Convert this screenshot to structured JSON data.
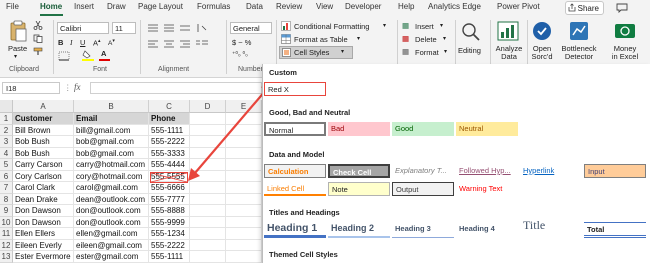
{
  "tabs": [
    "File",
    "Home",
    "Insert",
    "Draw",
    "Page Layout",
    "Formulas",
    "Data",
    "Review",
    "View",
    "Developer",
    "Help",
    "Analytics Edge",
    "Power Pivot"
  ],
  "share_label": "Share",
  "ribbon": {
    "paste": "Paste",
    "clipboard": "Clipboard",
    "font_name": "Calibri",
    "font_size": "11",
    "font_group": "Font",
    "alignment": "Alignment",
    "number_format": "General",
    "currency": "$ ~ %",
    "number_group": "Number",
    "conditional_formatting": "Conditional Formatting",
    "format_as_table": "Format as Table",
    "cell_styles": "Cell Styles",
    "insert": "Insert",
    "delete": "Delete",
    "format": "Format",
    "editing": "Editing",
    "analyze_data": "Analyze Data",
    "open_sorcd": "Open Sorc'd",
    "bottleneck_detector": "Bottleneck Detector",
    "money_in_excel": "Money in Excel"
  },
  "name_box": "I18",
  "fx_label": "fx",
  "grid": {
    "columns": [
      "A",
      "B",
      "C",
      "D",
      "E"
    ],
    "rows": [
      [
        "Customer",
        "Email",
        "Phone"
      ],
      [
        "Bill Brown",
        "bill@gmail.com",
        "555-1111"
      ],
      [
        "Bob Bush",
        "bob@gmail.com",
        "555-2222"
      ],
      [
        "Bob Bush",
        "bob@gmail.com",
        "555-3333"
      ],
      [
        "Carry Carson",
        "carry@hotmail.com",
        "555-4444"
      ],
      [
        "Cory Carlson",
        "cory@hotmail.com",
        "555-5555"
      ],
      [
        "Carol Clark",
        "carol@gmail.com",
        "555-6666"
      ],
      [
        "Dean Drake",
        "dean@outlook.com",
        "555-7777"
      ],
      [
        "Don Dawson",
        "don@outlook.com",
        "555-8888"
      ],
      [
        "Don Dawson",
        "don@outlook.com",
        "555-9999"
      ],
      [
        "Ellen Ellers",
        "ellen@gmail.com",
        "555-1234"
      ],
      [
        "Eileen Everly",
        "eileen@gmail.com",
        "555-2222"
      ],
      [
        "Ester Evermore",
        "ester@gmail.com",
        "555-1111"
      ]
    ]
  },
  "cell_styles_panel": {
    "custom_title": "Custom",
    "custom_style": "Red X",
    "good_bad_title": "Good, Bad and Neutral",
    "normal": "Normal",
    "bad": "Bad",
    "good": "Good",
    "neutral": "Neutral",
    "data_model_title": "Data and Model",
    "calculation": "Calculation",
    "check_cell": "Check Cell",
    "explanatory": "Explanatory T...",
    "followed_hyp": "Followed Hyp...",
    "hyperlink": "Hyperlink",
    "input": "Input",
    "linked_cell": "Linked Cell",
    "note": "Note",
    "output": "Output",
    "warning": "Warning Text",
    "titles_title": "Titles and Headings",
    "heading1": "Heading 1",
    "heading2": "Heading 2",
    "heading3": "Heading 3",
    "heading4": "Heading 4",
    "title": "Title",
    "total": "Total",
    "themed_title": "Themed Cell Styles"
  },
  "colors": {
    "accent": "#217346",
    "arrow": "#e8453c",
    "bad_bg": "#ffc7ce",
    "good_bg": "#c6efce",
    "neutral_bg": "#ffeb9c",
    "input_bg": "#ffcc99"
  }
}
